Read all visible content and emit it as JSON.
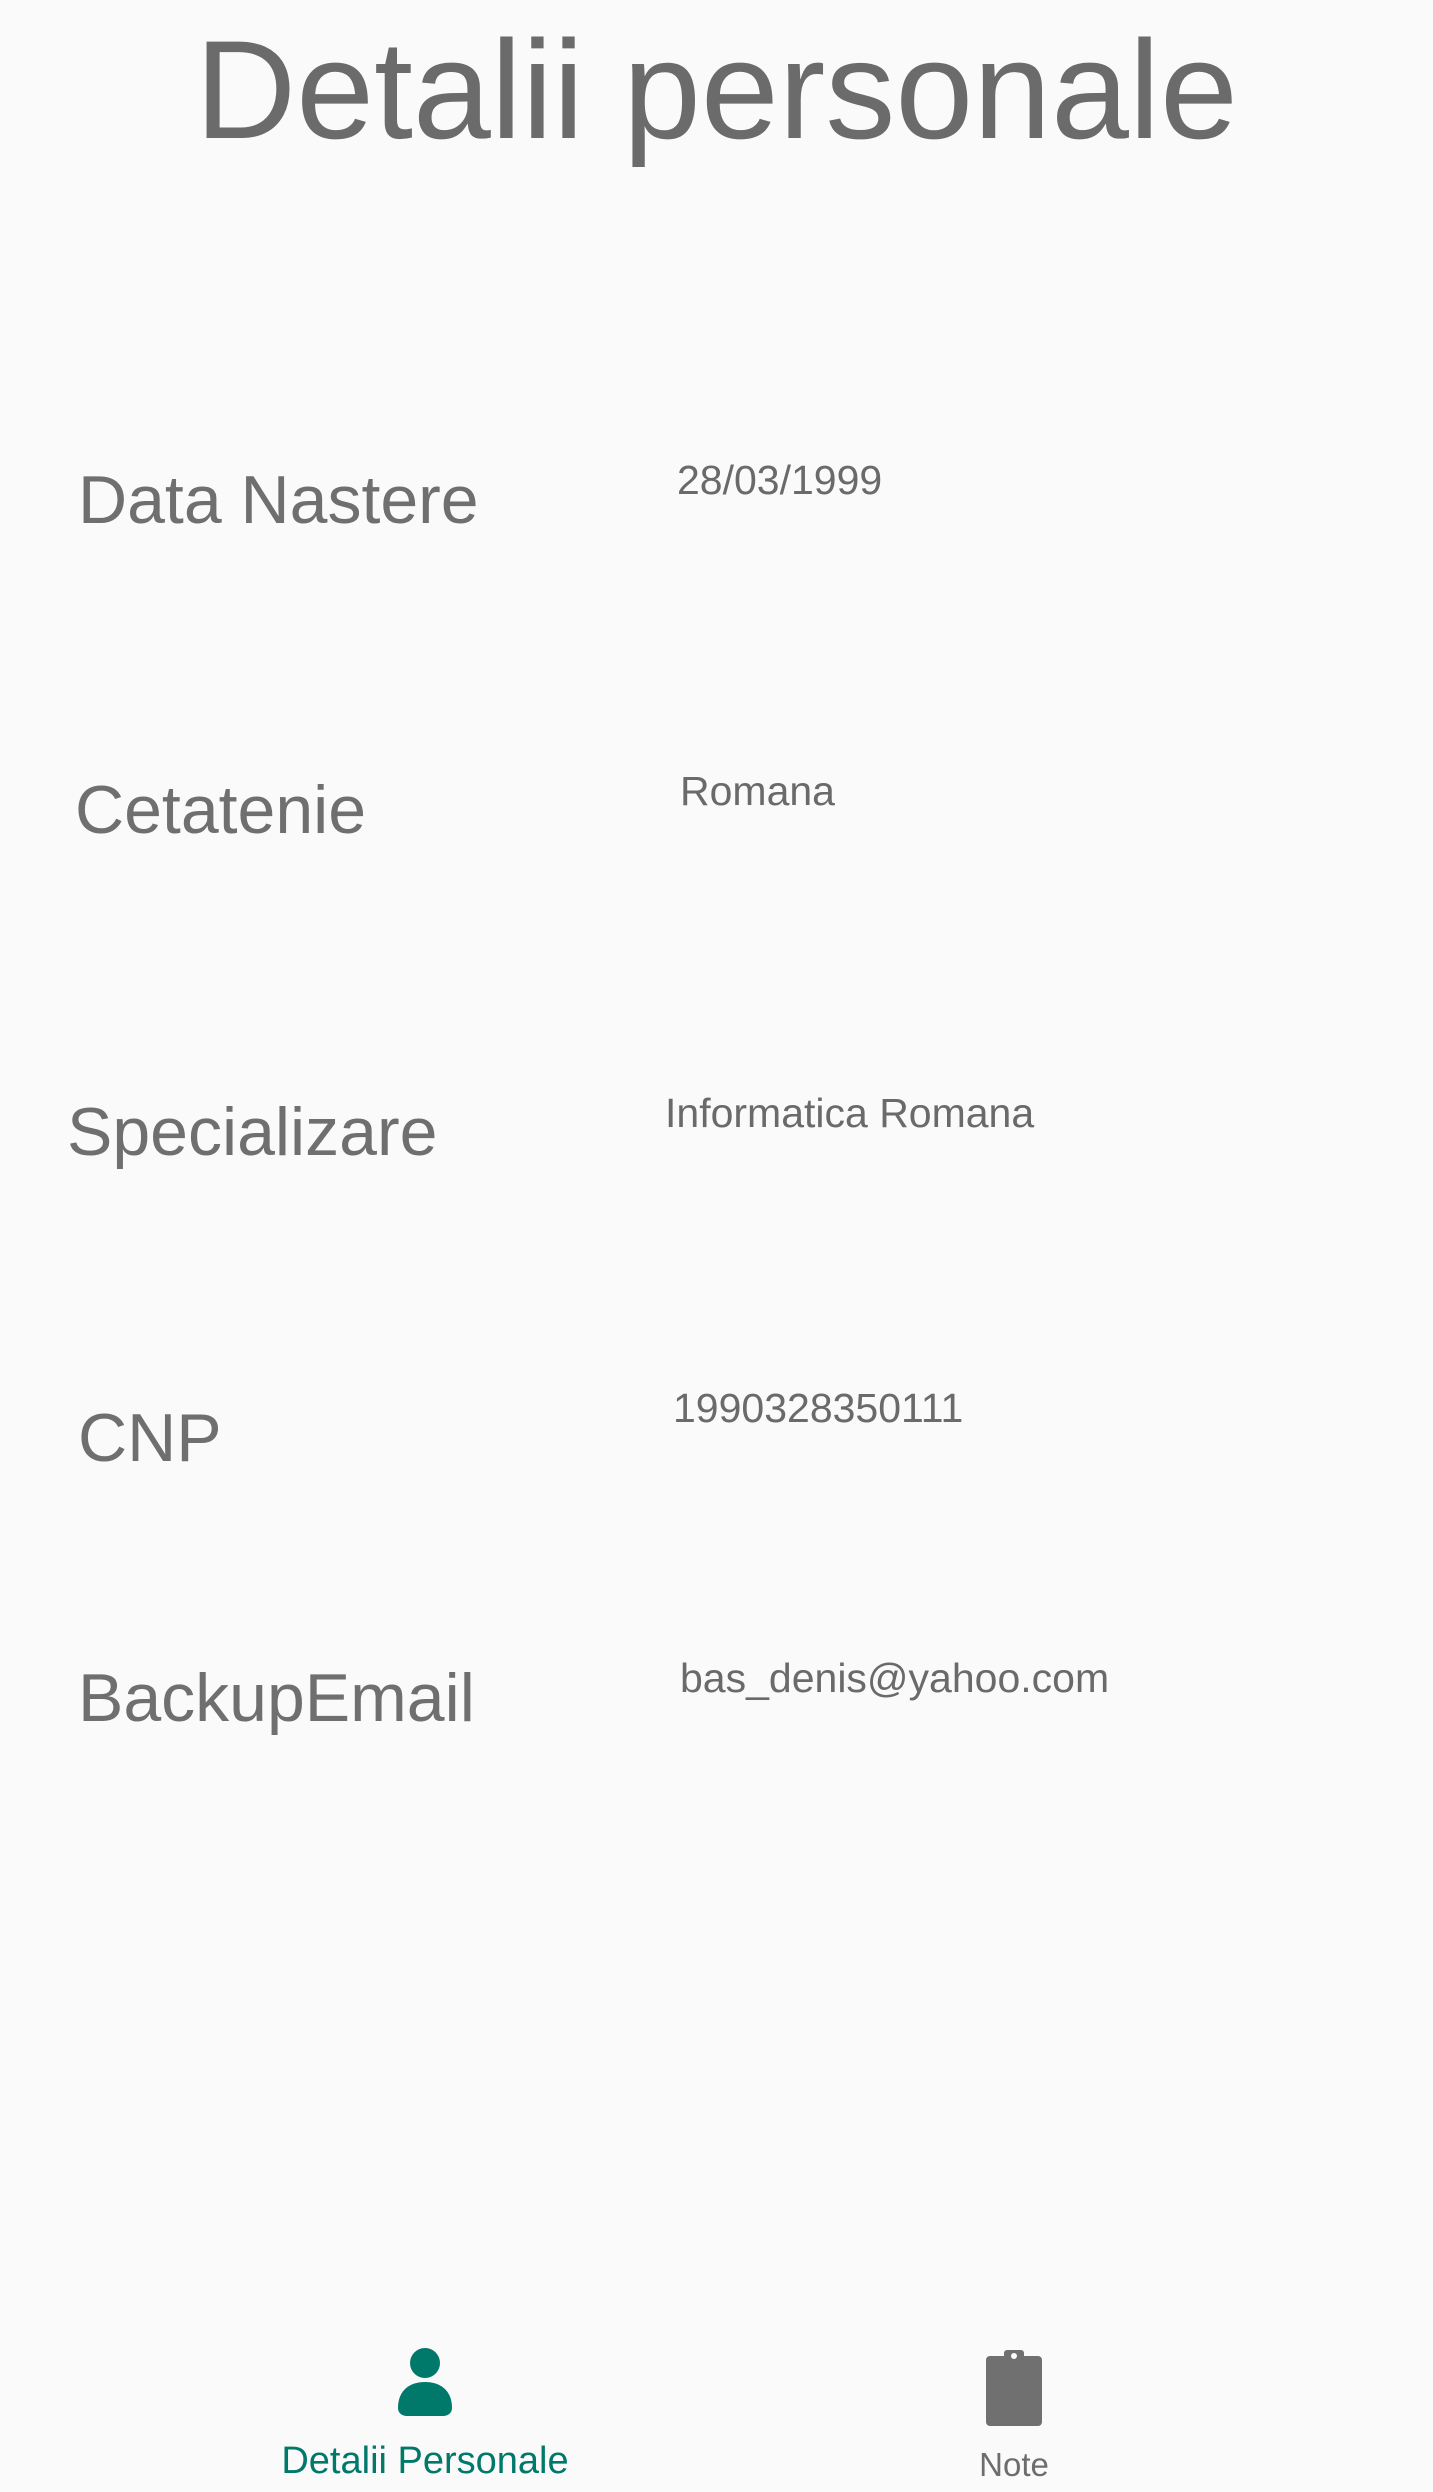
{
  "header": {
    "title": "Detalii personale"
  },
  "fields": [
    {
      "label": "Data Nastere",
      "value": "28/03/1999"
    },
    {
      "label": "Cetatenie",
      "value": "Romana"
    },
    {
      "label": "Specializare",
      "value": "Informatica Romana"
    },
    {
      "label": "CNP",
      "value": "1990328350111"
    },
    {
      "label": "BackupEmail",
      "value": "bas_denis@yahoo.com"
    }
  ],
  "bottom_nav": {
    "items": [
      {
        "label": "Detalii Personale",
        "icon": "person-icon",
        "active": true
      },
      {
        "label": "Note",
        "icon": "clipboard-icon",
        "active": false
      }
    ]
  },
  "colors": {
    "accent": "#00796b",
    "text": "#6d6d6d",
    "background": "#fafafa",
    "inactive_icon": "#707070"
  }
}
